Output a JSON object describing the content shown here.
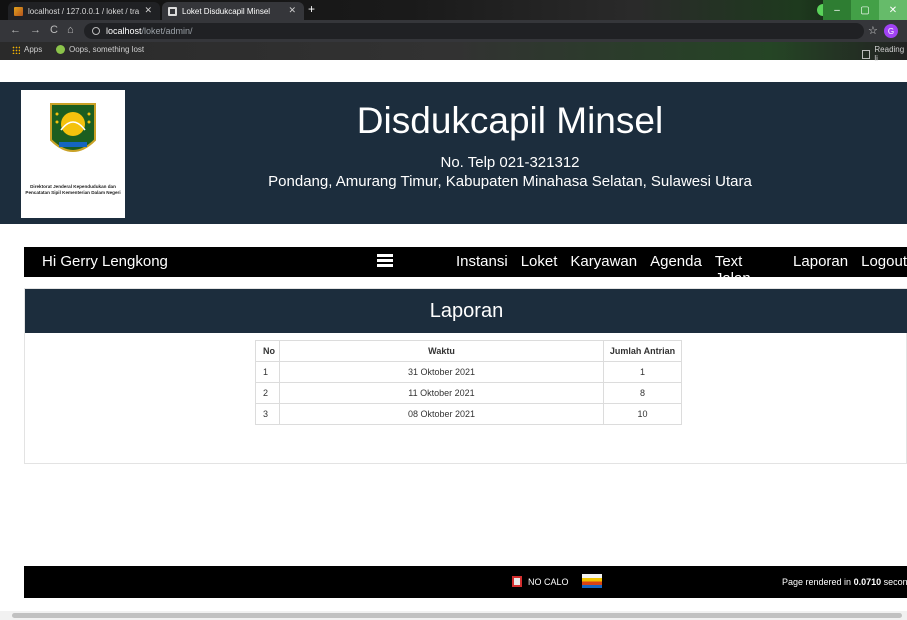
{
  "browser": {
    "tabs": [
      {
        "title": "localhost / 127.0.0.1 / loket / tra",
        "icon": "phpmyadmin-icon"
      },
      {
        "title": "Loket Disdukcapil Minsel",
        "icon": "monitor-icon"
      }
    ],
    "url_host": "localhost",
    "url_path": "/loket/admin/",
    "profile_initial": "G",
    "bookmarks": {
      "apps": "Apps",
      "item1": "Oops, something lost",
      "reading_list": "Reading li"
    }
  },
  "header": {
    "logo_caption": "Direktorat Jenderal Kependudukan dan Pencatatan Sipil Kementerian Dalam Negeri",
    "title": "Disdukcapil Minsel",
    "phone": "No. Telp 021-321312",
    "address": "Pondang, Amurang Timur, Kabupaten Minahasa Selatan, Sulawesi Utara"
  },
  "nav": {
    "greeting": "Hi Gerry Lengkong",
    "links": [
      "Instansi",
      "Loket",
      "Karyawan",
      "Agenda",
      "Text Jalan",
      "Laporan",
      "Logout"
    ]
  },
  "report": {
    "title": "Laporan",
    "columns": [
      "No",
      "Waktu",
      "Jumlah Antrian"
    ],
    "rows": [
      {
        "no": "1",
        "waktu": "31 Oktober 2021",
        "jumlah": "1"
      },
      {
        "no": "2",
        "waktu": "11 Oktober 2021",
        "jumlah": "8"
      },
      {
        "no": "3",
        "waktu": "08 Oktober 2021",
        "jumlah": "10"
      }
    ]
  },
  "footer": {
    "nocalo": "NO CALO",
    "render_prefix": "Page rendered in ",
    "render_time": "0.0710",
    "render_suffix": " seconds"
  },
  "colors": {
    "header_bg": "#1c2d3d",
    "nav_bg": "#000000"
  }
}
